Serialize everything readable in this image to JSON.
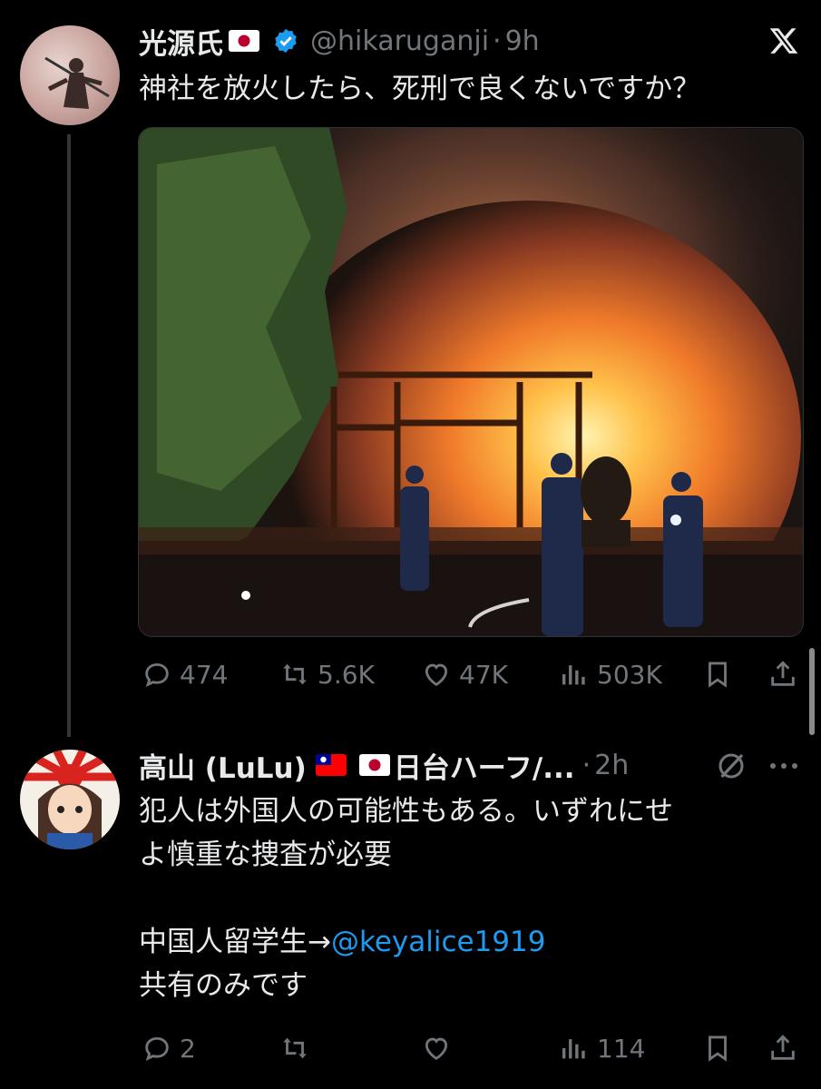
{
  "post": {
    "display_name": "光源氏",
    "handle": "@hikaruganji",
    "separator": "·",
    "time": "9h",
    "text": "神社を放火したら、死刑で良くないですか？",
    "actions": {
      "replies": "474",
      "reposts": "5.6K",
      "likes": "47K",
      "views": "503K"
    }
  },
  "reply": {
    "display_name": "高山 (LuLu)",
    "name_suffix": "日台ハーフ/...",
    "separator": "·",
    "time": "2h",
    "text_line1": "犯人は外国人の可能性もある。いずれにせ",
    "text_line2": "よ慎重な捜査が必要",
    "text_line3_prefix": "中国人留学生→",
    "mention": "@keyalice1919",
    "text_line4": "共有のみです",
    "actions": {
      "replies": "2",
      "views": "114"
    }
  },
  "colors": {
    "background": "#000000",
    "text": "#e7e9ea",
    "muted": "#71767b",
    "link": "#1d9bf0",
    "verified": "#1d9bf0"
  },
  "icons": [
    "x-logo-icon",
    "verified-badge-icon",
    "reply-icon",
    "repost-icon",
    "like-icon",
    "views-icon",
    "bookmark-icon",
    "share-icon",
    "grok-icon",
    "more-icon"
  ]
}
